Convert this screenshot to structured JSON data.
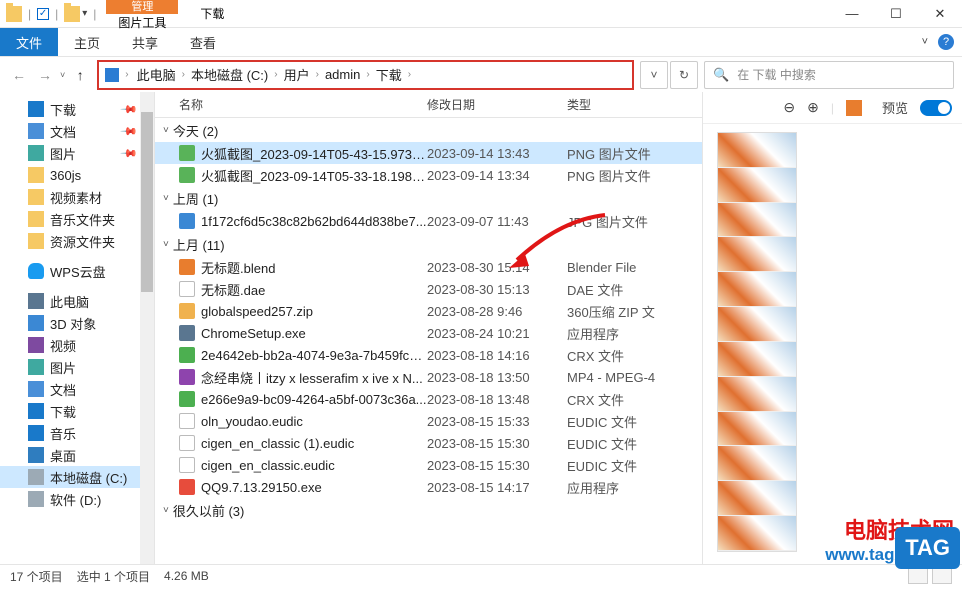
{
  "titlebar": {
    "context_group": "管理",
    "context_tab": "图片工具",
    "title": "下载"
  },
  "ribbon": {
    "file": "文件",
    "home": "主页",
    "share": "共享",
    "view": "查看"
  },
  "breadcrumb": {
    "items": [
      "此电脑",
      "本地磁盘 (C:)",
      "用户",
      "admin",
      "下载"
    ]
  },
  "search": {
    "placeholder": "在 下载 中搜索"
  },
  "columns": {
    "name": "名称",
    "date": "修改日期",
    "type": "类型"
  },
  "sidebar": {
    "quick": [
      {
        "label": "下载",
        "icon": "ico-dl",
        "pinned": true
      },
      {
        "label": "文档",
        "icon": "ico-doc",
        "pinned": true
      },
      {
        "label": "图片",
        "icon": "ico-pic",
        "pinned": true
      },
      {
        "label": "360js",
        "icon": "ico-folder",
        "pinned": false
      },
      {
        "label": "视频素材",
        "icon": "ico-folder",
        "pinned": false
      },
      {
        "label": "音乐文件夹",
        "icon": "ico-folder",
        "pinned": false
      },
      {
        "label": "资源文件夹",
        "icon": "ico-folder",
        "pinned": false
      }
    ],
    "wps": "WPS云盘",
    "thispc": "此电脑",
    "pc_children": [
      {
        "label": "3D 对象",
        "icon": "ico-3d"
      },
      {
        "label": "视频",
        "icon": "ico-video"
      },
      {
        "label": "图片",
        "icon": "ico-pic"
      },
      {
        "label": "文档",
        "icon": "ico-doc"
      },
      {
        "label": "下载",
        "icon": "ico-dl"
      },
      {
        "label": "音乐",
        "icon": "ico-music"
      },
      {
        "label": "桌面",
        "icon": "ico-desktop"
      },
      {
        "label": "本地磁盘 (C:)",
        "icon": "ico-drive",
        "selected": true
      },
      {
        "label": "软件 (D:)",
        "icon": "ico-drive"
      }
    ]
  },
  "groups": [
    {
      "label": "今天 (2)",
      "files": [
        {
          "name": "火狐截图_2023-09-14T05-43-15.973Z...",
          "date": "2023-09-14 13:43",
          "type": "PNG 图片文件",
          "ico": "fi-png",
          "selected": true
        },
        {
          "name": "火狐截图_2023-09-14T05-33-18.198Z...",
          "date": "2023-09-14 13:34",
          "type": "PNG 图片文件",
          "ico": "fi-png"
        }
      ]
    },
    {
      "label": "上周 (1)",
      "files": [
        {
          "name": "1f172cf6d5c38c82b62bd644d838be7...",
          "date": "2023-09-07 11:43",
          "type": "JPG 图片文件",
          "ico": "fi-jpg"
        }
      ]
    },
    {
      "label": "上月 (11)",
      "files": [
        {
          "name": "无标题.blend",
          "date": "2023-08-30 15:14",
          "type": "Blender File",
          "ico": "fi-blend"
        },
        {
          "name": "无标题.dae",
          "date": "2023-08-30 15:13",
          "type": "DAE 文件",
          "ico": "fi-generic"
        },
        {
          "name": "globalspeed257.zip",
          "date": "2023-08-28 9:46",
          "type": "360压缩 ZIP 文",
          "ico": "fi-zip"
        },
        {
          "name": "ChromeSetup.exe",
          "date": "2023-08-24 10:21",
          "type": "应用程序",
          "ico": "fi-exe"
        },
        {
          "name": "2e4642eb-bb2a-4074-9e3a-7b459fc8...",
          "date": "2023-08-18 14:16",
          "type": "CRX 文件",
          "ico": "fi-crx"
        },
        {
          "name": "念经串烧丨itzy x lesserafim x ive x N...",
          "date": "2023-08-18 13:50",
          "type": "MP4 - MPEG-4",
          "ico": "fi-mp4"
        },
        {
          "name": "e266e9a9-bc09-4264-a5bf-0073c36a...",
          "date": "2023-08-18 13:48",
          "type": "CRX 文件",
          "ico": "fi-crx"
        },
        {
          "name": "oln_youdao.eudic",
          "date": "2023-08-15 15:33",
          "type": "EUDIC 文件",
          "ico": "fi-txt"
        },
        {
          "name": "cigen_en_classic (1).eudic",
          "date": "2023-08-15 15:30",
          "type": "EUDIC 文件",
          "ico": "fi-txt"
        },
        {
          "name": "cigen_en_classic.eudic",
          "date": "2023-08-15 15:30",
          "type": "EUDIC 文件",
          "ico": "fi-txt"
        },
        {
          "name": "QQ9.7.13.29150.exe",
          "date": "2023-08-15 14:17",
          "type": "应用程序",
          "ico": "fi-qq"
        }
      ]
    },
    {
      "label": "很久以前 (3)",
      "files": []
    }
  ],
  "preview": {
    "label": "预览"
  },
  "statusbar": {
    "count": "17 个项目",
    "selection": "选中 1 个项目",
    "size": "4.26 MB"
  },
  "watermark": {
    "line1": "电脑技术网",
    "line2": "www.tagxp.com",
    "tag": "TAG"
  }
}
